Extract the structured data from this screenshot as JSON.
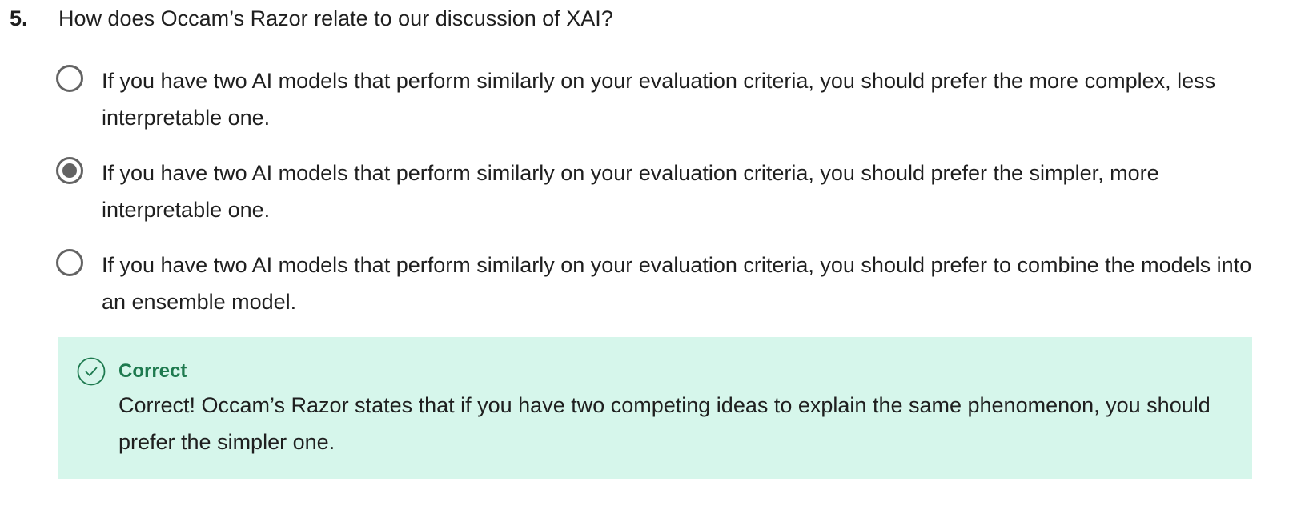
{
  "question": {
    "number": "5.",
    "text": "How does Occam’s Razor relate to our discussion of XAI?"
  },
  "options": [
    {
      "label": "If you have two AI models that perform similarly on your evaluation criteria, you should prefer the more complex, less interpretable one.",
      "selected": false
    },
    {
      "label": "If you have two AI models that perform similarly on your evaluation criteria, you should prefer the simpler, more interpretable one.",
      "selected": true
    },
    {
      "label": "If you have two AI models that perform similarly on your evaluation criteria, you should prefer to combine the models into an ensemble model.",
      "selected": false
    }
  ],
  "feedback": {
    "title": "Correct",
    "message": "Correct! Occam’s Razor states that if you have two competing ideas to explain the same phenomenon, you should prefer the simpler one.",
    "icon": "check-circle-icon",
    "accent_color": "#1e7a4f",
    "background_color": "#d6f6eb"
  },
  "colors": {
    "text": "#1f1f1f",
    "radio": "#636363"
  }
}
